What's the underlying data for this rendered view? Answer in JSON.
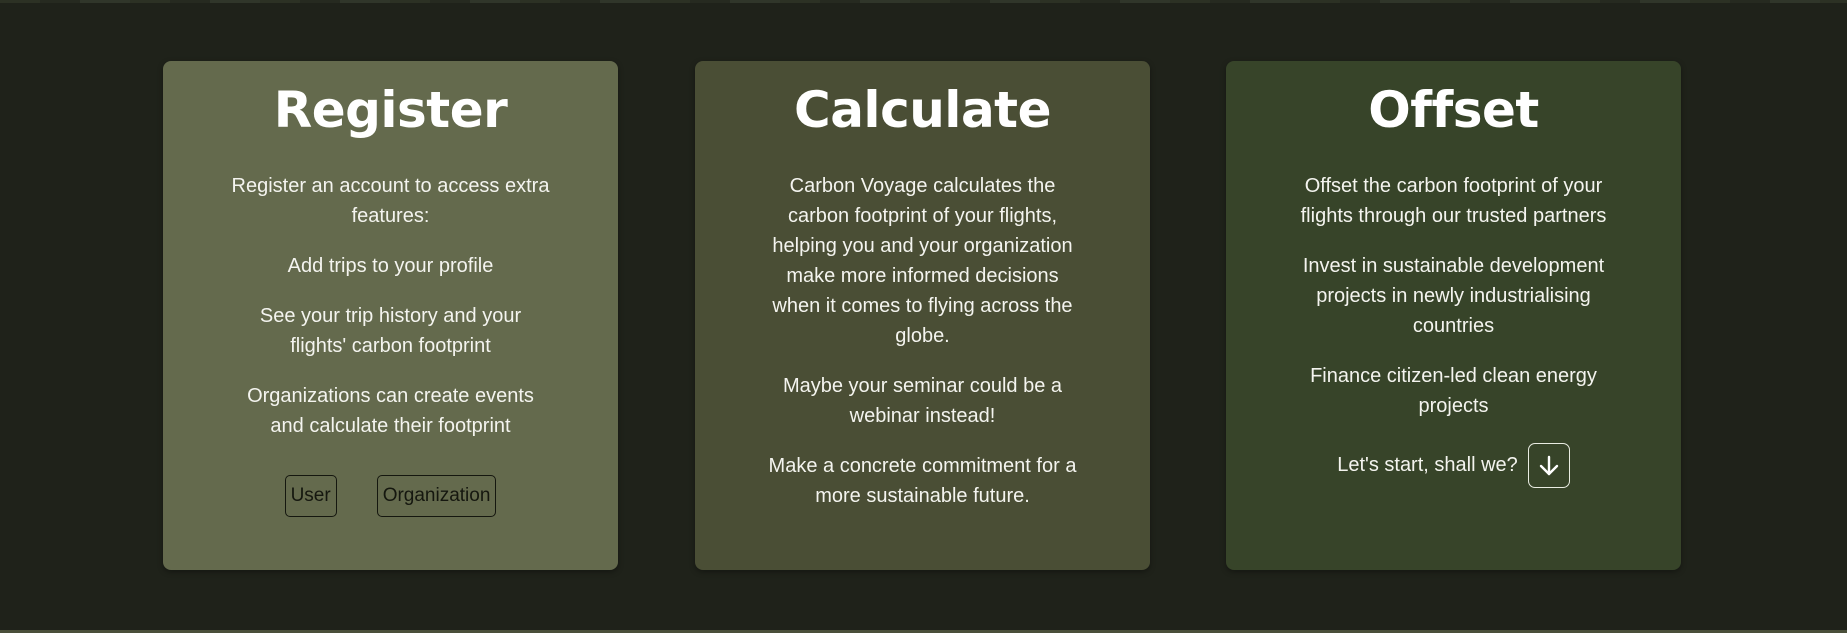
{
  "cards": {
    "register": {
      "title": "Register",
      "intro": "Register an account to access extra features:",
      "items": [
        "Add trips to your profile",
        "See your trip history and your flights' carbon footprint",
        "Organizations can create events and calculate their footprint"
      ],
      "buttons": {
        "user": "User",
        "organization": "Organization"
      }
    },
    "calculate": {
      "title": "Calculate",
      "paragraphs": [
        "Carbon Voyage calculates the carbon footprint of your flights, helping you and your organization make more informed decisions when it comes to flying across the globe.",
        "Maybe your seminar could be a webinar instead!",
        "Make a concrete commitment for a more sustainable future."
      ]
    },
    "offset": {
      "title": "Offset",
      "paragraphs": [
        "Offset the carbon footprint of your flights through our trusted partners",
        "Invest in sustainable development projects in newly industrialising countries",
        "Finance citizen-led clean energy projects"
      ],
      "cta_text": "Let's start, shall we?",
      "cta_icon": "arrow-down-icon"
    }
  },
  "colors": {
    "page_background": "#1f221a",
    "register_card": "#646a4d",
    "calculate_card": "#4a4e35",
    "offset_card": "#374429"
  }
}
